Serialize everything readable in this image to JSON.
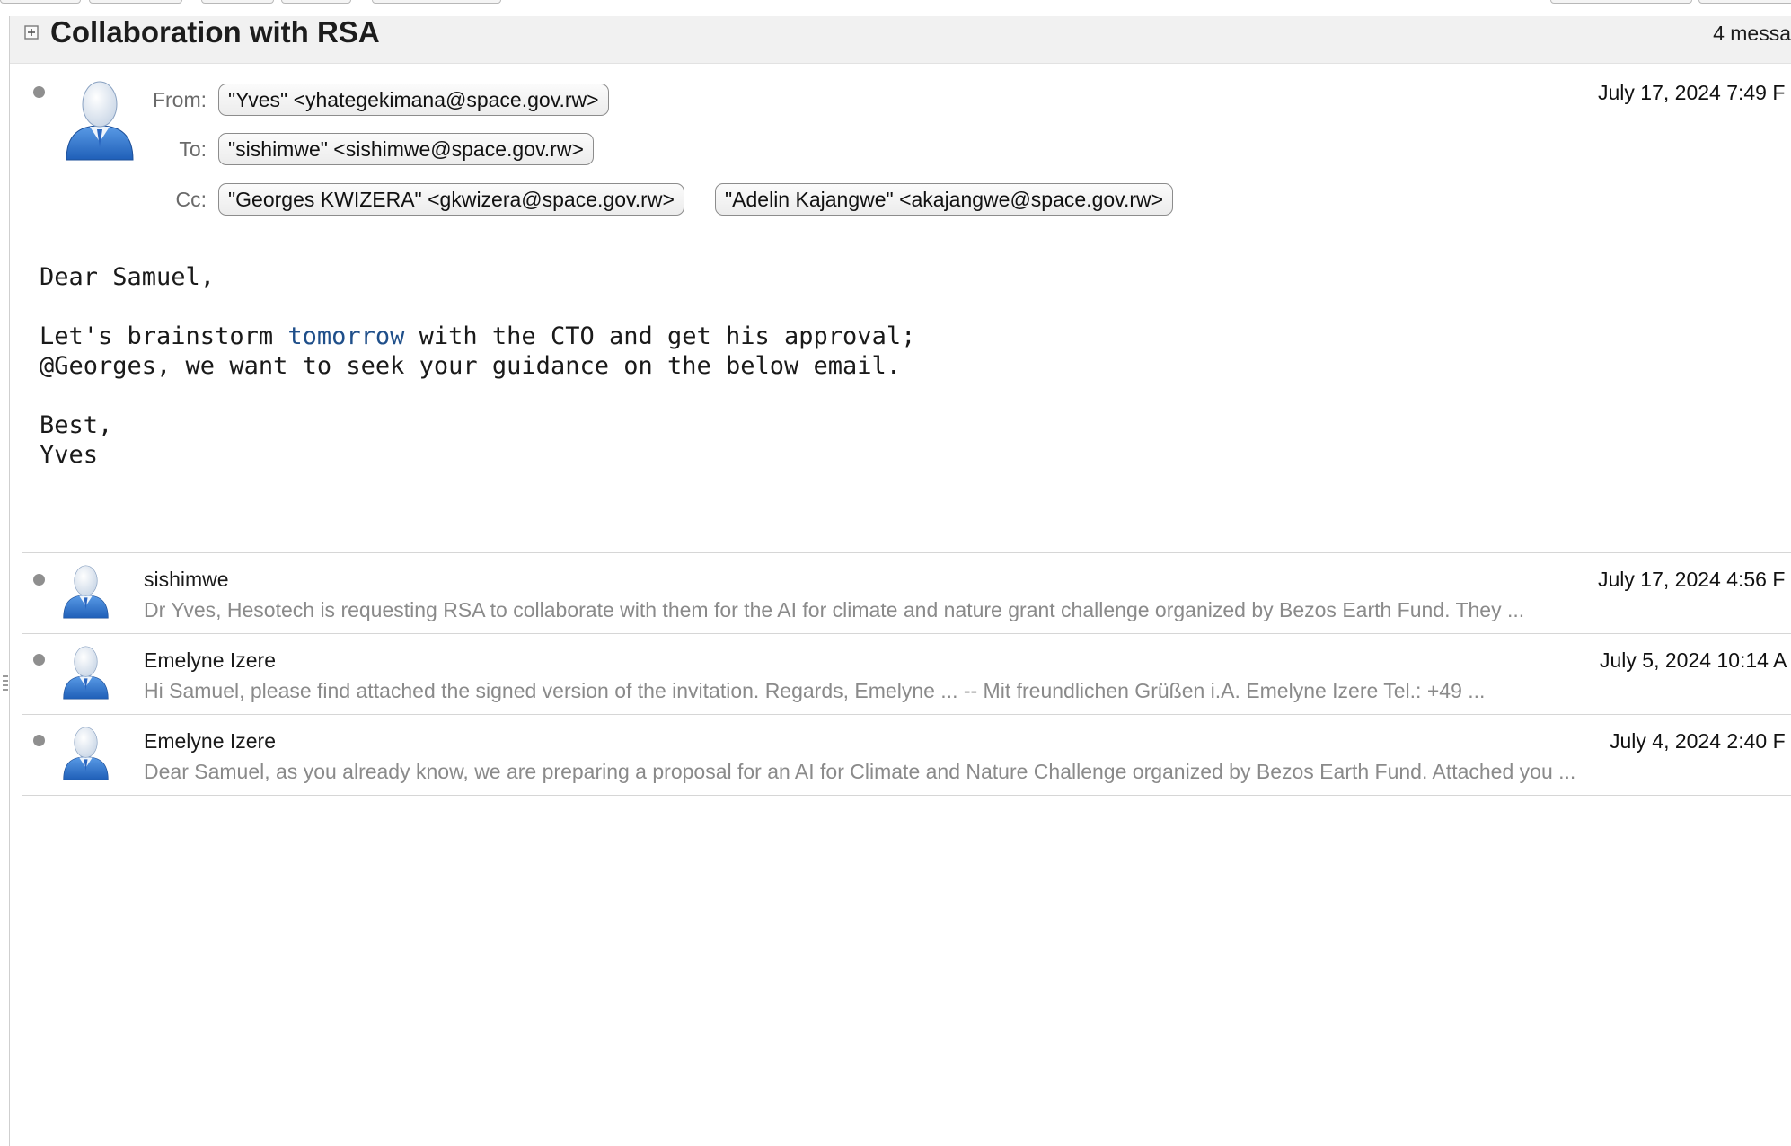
{
  "thread": {
    "title": "Collaboration with RSA",
    "count": "4 messa"
  },
  "expanded_message": {
    "from_label": "From:",
    "from": "\"Yves\" <yhategekimana@space.gov.rw>",
    "to_label": "To:",
    "to": "\"sishimwe\" <sishimwe@space.gov.rw>",
    "cc_label": "Cc:",
    "cc": [
      "\"Georges KWIZERA\" <gkwizera@space.gov.rw>",
      "\"Adelin Kajangwe\" <akajangwe@space.gov.rw>"
    ],
    "date": "July 17, 2024 7:49 F",
    "body": {
      "greeting": "Dear Samuel,",
      "line1_before": "Let's brainstorm ",
      "line1_link": "tomorrow",
      "line1_after": " with the CTO and get his approval;",
      "line2": "@Georges, we want to seek your guidance on the below email.",
      "closing": "Best,",
      "signature": "Yves"
    }
  },
  "collapsed_messages": [
    {
      "sender": "sishimwe",
      "date": "July 17, 2024 4:56 F",
      "snippet": "Dr Yves, Hesotech is requesting RSA to collaborate with them for the AI for climate and nature grant challenge organized by Bezos Earth Fund. They ..."
    },
    {
      "sender": "Emelyne Izere",
      "date": "July 5, 2024 10:14 A",
      "snippet": "Hi Samuel, please find attached the signed version of the invitation. Regards, Emelyne ... -- Mit freundlichen Grüßen i.A. Emelyne Izere Tel.: +49 ..."
    },
    {
      "sender": "Emelyne Izere",
      "date": "July 4, 2024 2:40 F",
      "snippet": "Dear Samuel, as you already know, we are preparing a proposal for an AI for Climate and Nature Challenge organized by Bezos Earth Fund. Attached you ..."
    }
  ],
  "colors": {
    "header_bg": "#f1f1f1",
    "link": "#1f4f8a",
    "snippet": "#8a8a8a",
    "avatar_blue": "#2f73c9"
  },
  "icons": {
    "expand": "plus-box-icon",
    "avatar": "user-avatar-icon",
    "unread": "bullet-icon",
    "grip": "resize-grip-icon"
  }
}
